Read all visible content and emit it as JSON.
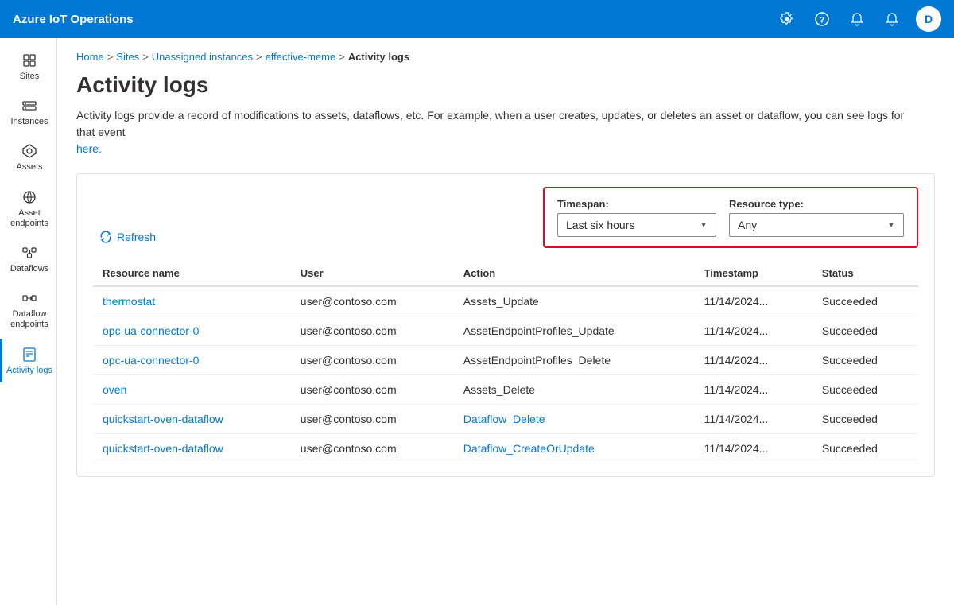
{
  "app": {
    "title": "Azure IoT Operations"
  },
  "topbar": {
    "title": "Azure IoT Operations",
    "icons": [
      "settings",
      "help",
      "notifications-silent",
      "bell"
    ],
    "avatar_label": "D"
  },
  "breadcrumb": {
    "items": [
      {
        "label": "Home",
        "link": true
      },
      {
        "label": "Sites",
        "link": true
      },
      {
        "label": "Unassigned instances",
        "link": true
      },
      {
        "label": "effective-meme",
        "link": true
      },
      {
        "label": "Activity logs",
        "link": false
      }
    ]
  },
  "page": {
    "title": "Activity logs",
    "description_part1": "Activity logs provide a record of modifications to assets, dataflows, etc. For example, when a user creates, updates, or deletes an asset or dataflow, you can see logs for that event",
    "description_here": "here.",
    "timespan_label": "Timespan:",
    "timespan_value": "Last six hours",
    "resource_type_label": "Resource type:",
    "resource_type_value": "Any",
    "refresh_label": "Refresh"
  },
  "table": {
    "headers": [
      "Resource name",
      "User",
      "Action",
      "Timestamp",
      "Status"
    ],
    "rows": [
      {
        "resource_name": "thermostat",
        "user": "user@contoso.com",
        "action": "Assets_Update",
        "timestamp": "11/14/2024...",
        "status": "Succeeded"
      },
      {
        "resource_name": "opc-ua-connector-0",
        "user": "user@contoso.com",
        "action": "AssetEndpointProfiles_Update",
        "timestamp": "11/14/2024...",
        "status": "Succeeded"
      },
      {
        "resource_name": "opc-ua-connector-0",
        "user": "user@contoso.com",
        "action": "AssetEndpointProfiles_Delete",
        "timestamp": "11/14/2024...",
        "status": "Succeeded"
      },
      {
        "resource_name": "oven",
        "user": "user@contoso.com",
        "action": "Assets_Delete",
        "timestamp": "11/14/2024...",
        "status": "Succeeded"
      },
      {
        "resource_name": "quickstart-oven-dataflow",
        "user": "user@contoso.com",
        "action": "Dataflow_Delete",
        "timestamp": "11/14/2024...",
        "status": "Succeeded"
      },
      {
        "resource_name": "quickstart-oven-dataflow",
        "user": "user@contoso.com",
        "action": "Dataflow_CreateOrUpdate",
        "timestamp": "11/14/2024...",
        "status": "Succeeded"
      }
    ]
  },
  "sidebar": {
    "items": [
      {
        "label": "Sites",
        "icon": "sites",
        "active": false
      },
      {
        "label": "Instances",
        "icon": "instances",
        "active": false
      },
      {
        "label": "Assets",
        "icon": "assets",
        "active": false
      },
      {
        "label": "Asset endpoints",
        "icon": "asset-endpoints",
        "active": false
      },
      {
        "label": "Dataflows",
        "icon": "dataflows",
        "active": false
      },
      {
        "label": "Dataflow endpoints",
        "icon": "dataflow-endpoints",
        "active": false
      },
      {
        "label": "Activity logs",
        "icon": "activity-logs",
        "active": true
      }
    ]
  }
}
